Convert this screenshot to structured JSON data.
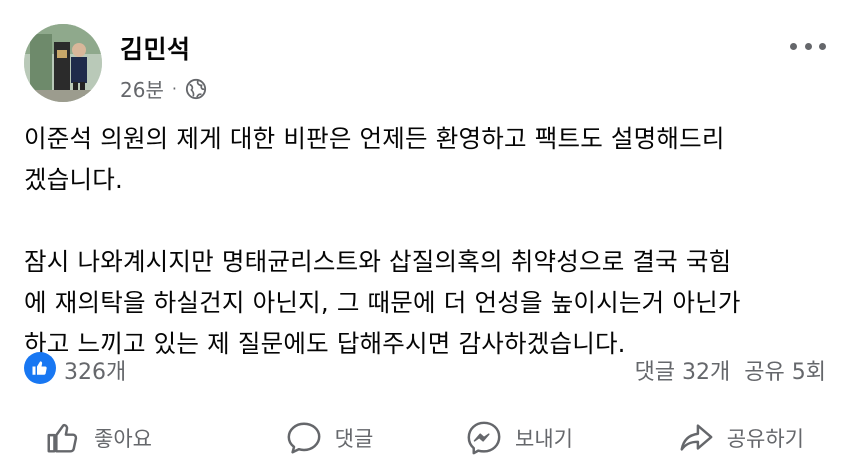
{
  "post": {
    "author": "김민석",
    "time": "26분",
    "separator": "·",
    "paragraphs": [
      "이준석 의원의 제게 대한 비판은 언제든 환영하고 팩트도 설명해드리겠습니다.",
      "잠시 나와계시지만 명태균리스트와 삽질의혹의 취약성으로 결국 국힘에 재의탁을 하실건지 아닌지, 그 때문에 더 언성을 높이시는거 아닌가 하고 느끼고 있는 제 질문에도 답해주시면 감사하겠습니다."
    ],
    "text_lines_p1": [
      "이준석 의원의 제게 대한 비판은 언제든 환영하고 팩트도 설명해드리",
      "겠습니다."
    ],
    "text_lines_p2": [
      "잠시 나와계시지만 명태균리스트와 삽질의혹의 취약성으로 결국 국힘",
      "에 재의탁을 하실건지 아닌지, 그 때문에 더 언성을 높이시는거 아닌가",
      "하고 느끼고 있는 제 질문에도 답해주시면 감사하겠습니다."
    ]
  },
  "stats": {
    "likes": "326개",
    "comments": "댓글 32개",
    "shares": "공유 5회"
  },
  "actions": {
    "like": "좋아요",
    "comment": "댓글",
    "send": "보내기",
    "share": "공유하기"
  },
  "colors": {
    "accent": "#1877f2",
    "secondary_text": "#65676b"
  },
  "icons": [
    "globe-icon",
    "more-icon",
    "like-badge-icon",
    "thumbs-up-icon",
    "comment-icon",
    "messenger-icon",
    "share-icon"
  ]
}
